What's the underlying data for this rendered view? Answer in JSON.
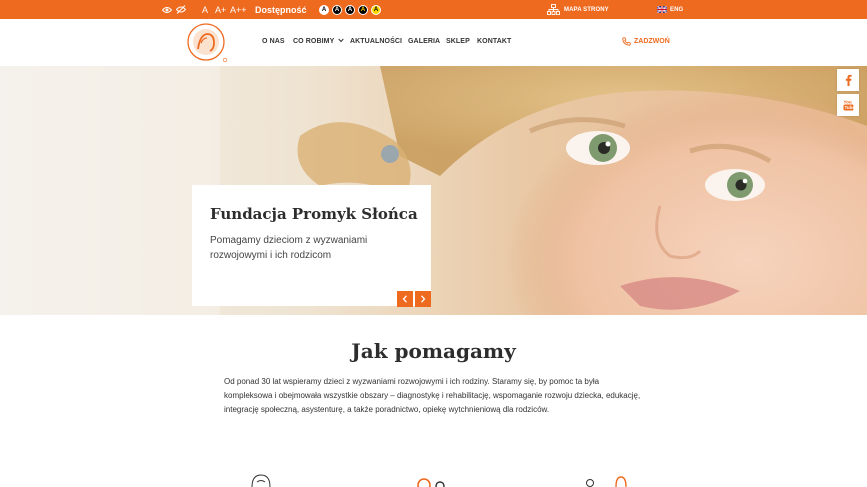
{
  "topbar": {
    "font_small": "A",
    "font_medium": "A+",
    "font_large": "A++",
    "accessibility_label": "Dostępność",
    "contrast_letter": "A",
    "sitemap_label": "MAPA STRONY",
    "language_label": "ENG"
  },
  "nav": {
    "items": [
      "O NAS",
      "CO ROBIMY",
      "AKTUALNOŚCI",
      "GALERIA",
      "SKLEP",
      "KONTAKT"
    ],
    "call_label": "ZADZWOŃ"
  },
  "hero": {
    "title": "Fundacja Promyk Słońca",
    "subtitle": "Pomagamy dzieciom z wyzwaniami rozwojowymi i ich rodzicom"
  },
  "section": {
    "title": "Jak pomagamy",
    "text": "Od ponad 30 lat wspieramy dzieci z wyzwaniami rozwojowymi i ich rodziny. Staramy się, by pomoc ta była kompleksowa i obejmowała wszystkie obszary – diagnostykę i rehabilitację, wspomaganie rozwoju dziecka, edukację, integrację społeczną, asystenturę, a także poradnictwo, opiekę wytchnieniową dla rodziców."
  },
  "colors": {
    "brand": "#ee6a1f",
    "text": "#333333"
  }
}
